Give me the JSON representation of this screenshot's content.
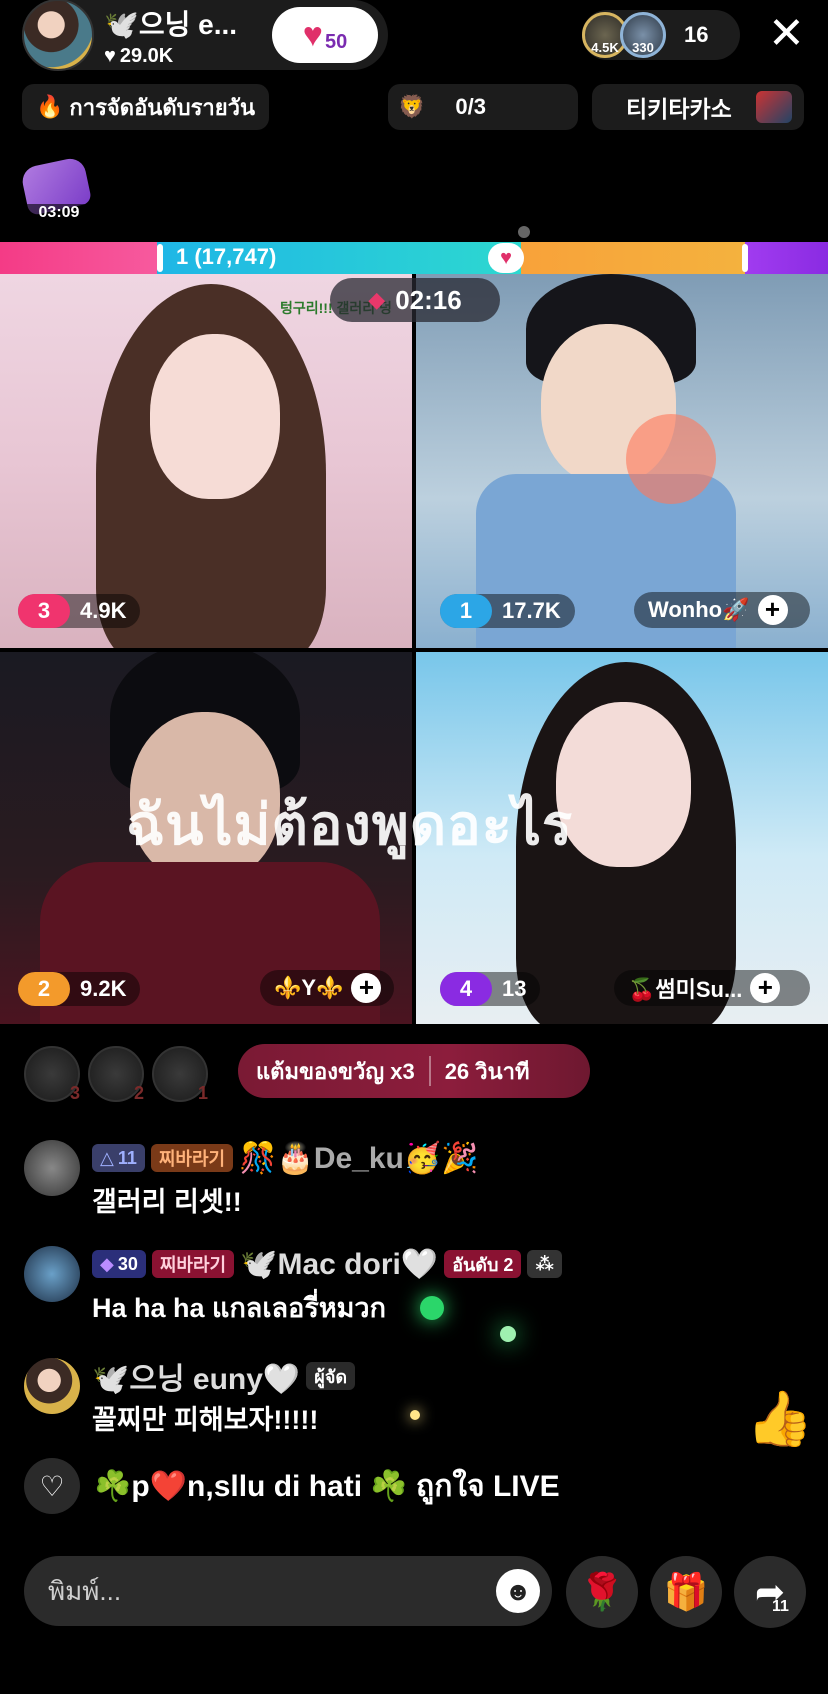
{
  "host": {
    "name": "🕊️으닝 e...",
    "likes": "29.0K",
    "heart_level": "50"
  },
  "viewers": {
    "avatar1_label": "4.5K",
    "avatar2_label": "330",
    "count": "16"
  },
  "top_pills": {
    "daily_rank": "การจัดอันดับรายวัน",
    "lion_progress": "0/3",
    "tiki": "티키타카소"
  },
  "bag_timer": "03:09",
  "score": {
    "label": "1 (17,747)",
    "shares": {
      "pink": 0.19,
      "blue": 0.44,
      "orange": 0.27,
      "purple": 0.1
    }
  },
  "battle_timer": "02:16",
  "tiles": [
    {
      "rank": "3",
      "score": "4.9K",
      "name": "",
      "rank_color": "#f0346e"
    },
    {
      "rank": "1",
      "score": "17.7K",
      "name": "Wonho🚀",
      "rank_color": "#2ca6e6"
    },
    {
      "rank": "2",
      "score": "9.2K",
      "name": "⚜️Y⚜️",
      "rank_color": "#f39a2b"
    },
    {
      "rank": "4",
      "score": "13",
      "name": "🍒썸미Su...",
      "rank_color": "#8a2be2"
    }
  ],
  "tile1_overlay": "텅구리!!!  갤러리 덩",
  "caption": "ฉันไม่ต้องพูดอะไร",
  "gift_multiplier": {
    "points": "แต้มของขวัญ x3",
    "seconds": "26 วินาที",
    "ranks": [
      "3",
      "2",
      "1"
    ]
  },
  "chat": [
    {
      "badges": [
        "11",
        "찌바라기"
      ],
      "name": "🎊🎂De_ku🥳🎉",
      "text": "갤러리 리셋!!"
    },
    {
      "badges": [
        "30",
        "찌바라기"
      ],
      "name": "🕊️Mac dori🤍",
      "rank_badge": "อันดับ 2",
      "text": "Ha ha ha แกลเลอรี่หมวก"
    },
    {
      "name": "🕊️으닝 euny🤍",
      "role": "ผู้จัด",
      "text": "꼴찌만 피해보자!!!!!"
    }
  ],
  "live_line": "☘️p❤️n,sllu di hati ☘️ ถูกใจ LIVE",
  "input": {
    "placeholder": "พิมพ์..."
  },
  "share_count": "11",
  "colors": {
    "accent_pink": "#e0306a",
    "bar_blue": "#1fb6e6",
    "bar_orange": "#f8a23a",
    "bar_purple": "#a13cf0",
    "multiplier_bg": "#7a1a34"
  }
}
